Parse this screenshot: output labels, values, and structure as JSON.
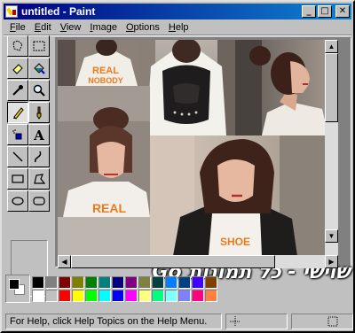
{
  "window": {
    "title": "untitled - Paint",
    "minimize_glyph": "_",
    "maximize_glyph": "□",
    "close_glyph": "✕"
  },
  "menu": [
    {
      "label": "File",
      "accel": "F",
      "rest": "ile"
    },
    {
      "label": "Edit",
      "accel": "E",
      "rest": "dit"
    },
    {
      "label": "View",
      "accel": "V",
      "rest": "iew"
    },
    {
      "label": "Image",
      "accel": "I",
      "rest": "mage"
    },
    {
      "label": "Options",
      "accel": "O",
      "rest": "ptions"
    },
    {
      "label": "Help",
      "accel": "H",
      "rest": "elp"
    }
  ],
  "tools": [
    {
      "name": "free-form-select-tool",
      "icon": "free-form-select-icon"
    },
    {
      "name": "select-tool",
      "icon": "select-icon"
    },
    {
      "name": "eraser-tool",
      "icon": "eraser-icon"
    },
    {
      "name": "fill-tool",
      "icon": "fill-bucket-icon"
    },
    {
      "name": "pick-color-tool",
      "icon": "eyedropper-icon"
    },
    {
      "name": "magnifier-tool",
      "icon": "magnifier-icon"
    },
    {
      "name": "pencil-tool",
      "icon": "pencil-icon",
      "active": true
    },
    {
      "name": "brush-tool",
      "icon": "brush-icon"
    },
    {
      "name": "airbrush-tool",
      "icon": "airbrush-icon"
    },
    {
      "name": "text-tool",
      "icon": "text-icon"
    },
    {
      "name": "line-tool",
      "icon": "line-icon"
    },
    {
      "name": "curve-tool",
      "icon": "curve-icon"
    },
    {
      "name": "rectangle-tool",
      "icon": "rectangle-icon"
    },
    {
      "name": "polygon-tool",
      "icon": "polygon-icon"
    },
    {
      "name": "ellipse-tool",
      "icon": "ellipse-icon"
    },
    {
      "name": "rounded-rectangle-tool",
      "icon": "rounded-rectangle-icon"
    }
  ],
  "canvas": {
    "caption": "Go שוישי - כל תמונות",
    "shirt_text_1": "REAL",
    "shirt_text_2": "NOBODY",
    "shirt_text_3": "SHOE"
  },
  "colors": {
    "foreground": "#000000",
    "background": "#ffffff",
    "palette_top": [
      "#000000",
      "#808080",
      "#800000",
      "#808000",
      "#008000",
      "#008080",
      "#000080",
      "#800080",
      "#808040",
      "#004040",
      "#0080ff",
      "#004080",
      "#4000ff",
      "#804000"
    ],
    "palette_bottom": [
      "#ffffff",
      "#c0c0c0",
      "#ff0000",
      "#ffff00",
      "#00ff00",
      "#00ffff",
      "#0000ff",
      "#ff00ff",
      "#ffff80",
      "#00ff80",
      "#80ffff",
      "#8080ff",
      "#ff0080",
      "#ff8040"
    ]
  },
  "status": {
    "help_text": "For Help, click Help Topics on the Help Menu."
  }
}
